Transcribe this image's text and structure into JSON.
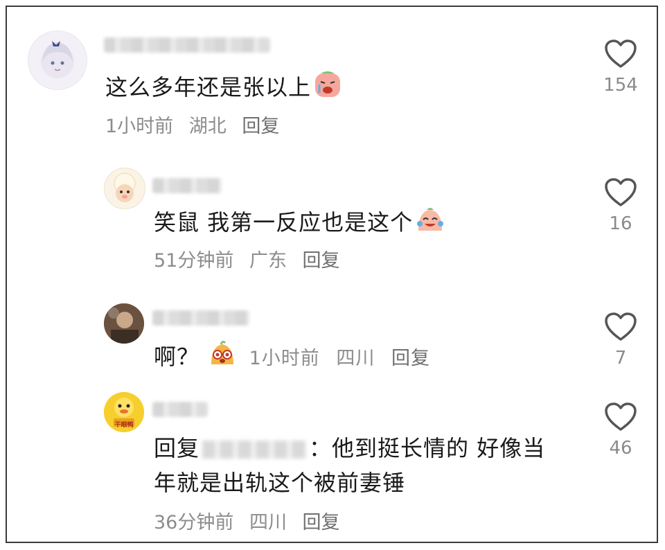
{
  "comments": [
    {
      "text": "这么多年还是张以上",
      "time": "1小时前",
      "location": "湖北",
      "reply_label": "回复",
      "likes": "154",
      "emoji_icon": "sad-crying-emoji-icon"
    },
    {
      "text": "笑鼠 我第一反应也是这个",
      "time": "51分钟前",
      "location": "广东",
      "reply_label": "回复",
      "likes": "16",
      "emoji_icon": "laughing-tears-emoji-icon"
    },
    {
      "text": "啊？",
      "time": "1小时前",
      "location": "四川",
      "reply_label": "回复",
      "likes": "7",
      "emoji_icon": "shocked-face-emoji-icon"
    },
    {
      "reply_prefix": "回复",
      "reply_sep": "：",
      "text_line1": "他到挺长情的 好像当",
      "text_line2": "年就是出轨这个被前妻锤",
      "time": "36分钟前",
      "location": "四川",
      "reply_label": "回复",
      "likes": "46",
      "avatar_label": "干眼鸭"
    }
  ],
  "colors": {
    "text": "#1a1a1a",
    "meta": "#8c8c8c",
    "heart": "#555555"
  }
}
